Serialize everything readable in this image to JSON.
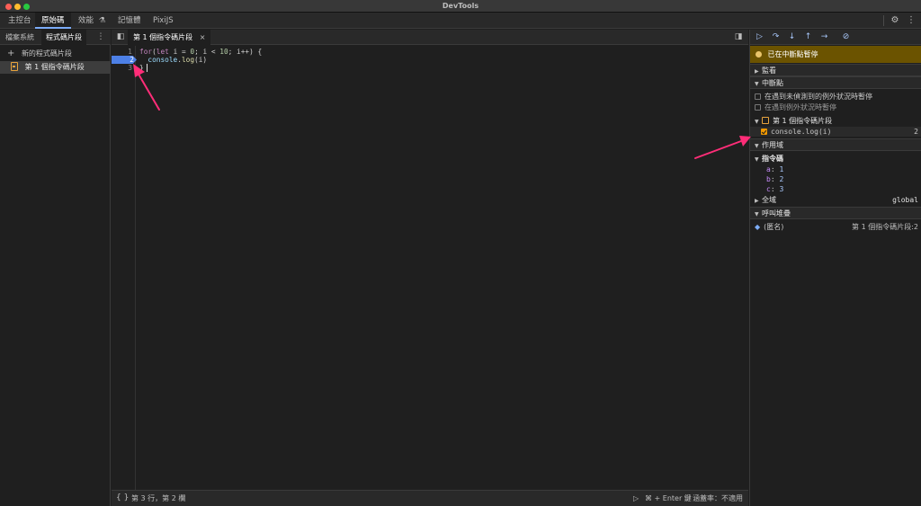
{
  "window": {
    "title": "DevTools",
    "traffic_colors": [
      "#ff5f57",
      "#febc2e",
      "#28c840"
    ]
  },
  "panel_tabs": [
    {
      "label": "主控台"
    },
    {
      "label": "原始碼"
    },
    {
      "label": "效能"
    },
    {
      "label": "記憶體"
    },
    {
      "label": "PixiJS"
    }
  ],
  "left": {
    "tabs": [
      {
        "label": "檔案系統"
      },
      {
        "label": "程式碼片段"
      }
    ],
    "new_snippet": "新的程式碼片段",
    "snippet_item": "第 1 個指令碼片段"
  },
  "editor": {
    "tab_label": "第 1 個指令碼片段",
    "line_numbers": [
      "1",
      "2",
      "3"
    ],
    "breakpoint_line": "2",
    "code": {
      "line1": {
        "kw": "for",
        "p1": "(",
        "kw2": "let",
        "p2": " i = ",
        "n0": "0",
        "p3": "; i < ",
        "n10": "10",
        "p4": "; i++) {"
      },
      "line2": {
        "indent": "  ",
        "obj": "console",
        "dot": ".",
        "fn": "log",
        "args": "(i)"
      },
      "line3": "}"
    },
    "status": {
      "position": "第 3 行，第 2 欄",
      "run_hint": "⌘ + Enter 鍵",
      "coverage": "涵蓋率：不適用"
    }
  },
  "debugger": {
    "paused_message": "已在中斷點暫停",
    "sections": {
      "watch": "監看",
      "breakpoints": "中斷點",
      "scope": "作用域",
      "call_stack": "呼叫堆疊"
    },
    "pause_uncaught": "在遇到未偵測到的例外狀況時暫停",
    "pause_caught": "在遇到例外狀況時暫停",
    "bp_file": "第 1 個指令碼片段",
    "bp_entry": {
      "code": "console.log(i)",
      "line": "2"
    },
    "scope": {
      "script_label": "指令碼",
      "vars": [
        {
          "key": "a",
          "value": "1"
        },
        {
          "key": "b",
          "value": "2"
        },
        {
          "key": "c",
          "value": "3"
        }
      ],
      "global_label": "全域",
      "global_value": "global"
    },
    "call_stack": {
      "frame": "(匿名)",
      "location": "第 1 個指令碼片段:2"
    }
  },
  "colors": {
    "accent": "#7cacf8",
    "breakpoint": "#4d80e6",
    "paused_banner": "#6b5300",
    "annotation_arrow": "#ff2d78"
  }
}
